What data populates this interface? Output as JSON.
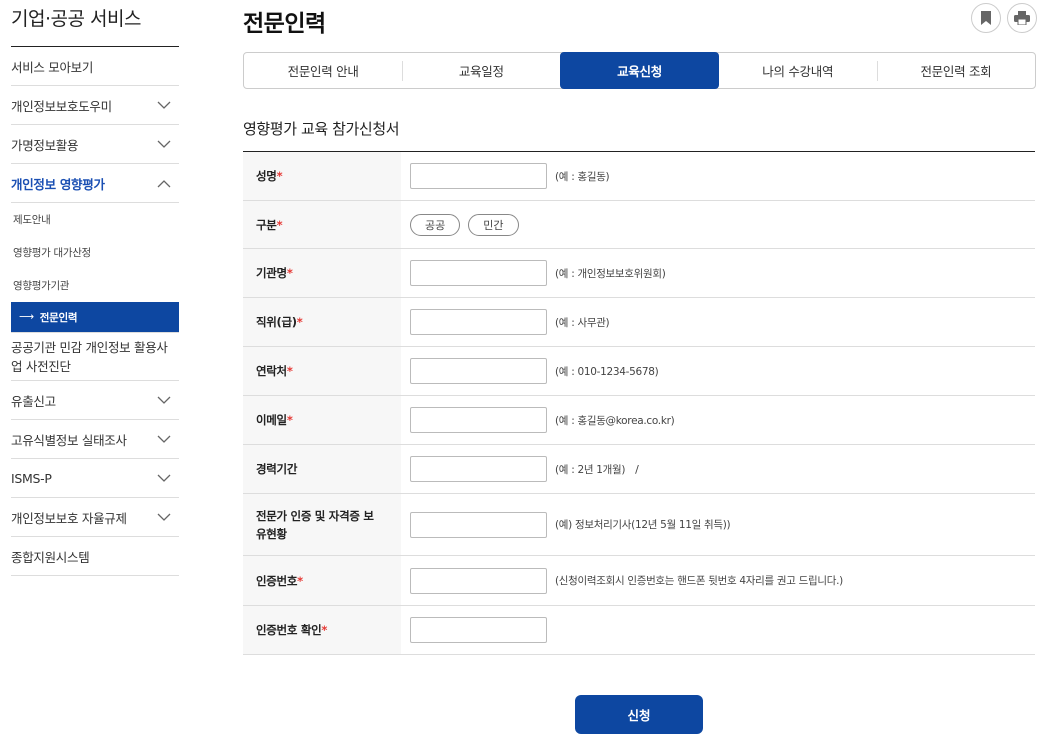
{
  "sidebar": {
    "title": "기업·공공 서비스",
    "items": [
      {
        "label": "서비스 모아보기"
      },
      {
        "label": "개인정보보호도우미"
      },
      {
        "label": "가명정보활용"
      },
      {
        "label": "개인정보 영향평가"
      },
      {
        "label": "공공기관 민감 개인정보 활용사업 사전진단"
      },
      {
        "label": "유출신고"
      },
      {
        "label": "고유식별정보 실태조사"
      },
      {
        "label": "ISMS-P"
      },
      {
        "label": "개인정보보호 자율규제"
      },
      {
        "label": "종합지원시스템"
      }
    ],
    "subitems": [
      {
        "label": "제도안내"
      },
      {
        "label": "영향평가 대가산정"
      },
      {
        "label": "영향평가기관"
      },
      {
        "label": "전문인력",
        "arrow": "⟶"
      }
    ]
  },
  "main": {
    "title": "전문인력",
    "tabs": [
      {
        "label": "전문인력 안내"
      },
      {
        "label": "교육일정"
      },
      {
        "label": "교육신청"
      },
      {
        "label": "나의 수강내역"
      },
      {
        "label": "전문인력 조회"
      }
    ],
    "form_title": "영향평가 교육 참가신청서",
    "fields": {
      "name": {
        "label": "성명",
        "hint": "(예 : 홍길동)"
      },
      "type": {
        "label": "구분",
        "options": [
          "공공",
          "민간"
        ]
      },
      "org": {
        "label": "기관명",
        "hint": "(예 : 개인정보보호위원회)"
      },
      "position": {
        "label": "직위(급)",
        "hint": "(예 : 사무관)"
      },
      "phone": {
        "label": "연락처",
        "hint": "(예 : 010-1234-5678)"
      },
      "email": {
        "label": "이메일",
        "hint": "(예 : 홍길동@korea.co.kr)"
      },
      "career": {
        "label": "경력기간",
        "hint": "(예 : 2년 1개월)",
        "slash": "/"
      },
      "cert": {
        "label": "전문가 인증 및 자격증 보유현황",
        "hint": "(예) 정보처리기사(12년 5월 11일 취득))"
      },
      "authno": {
        "label": "인증번호",
        "hint": "(신청이력조회시 인증번호는 핸드폰 뒷번호 4자리를 권고 드립니다.)"
      },
      "authno_confirm": {
        "label": "인증번호 확인"
      }
    },
    "required_mark": "*",
    "submit_label": "신청"
  },
  "colors": {
    "primary": "#0d47a1",
    "required": "#e53935"
  }
}
